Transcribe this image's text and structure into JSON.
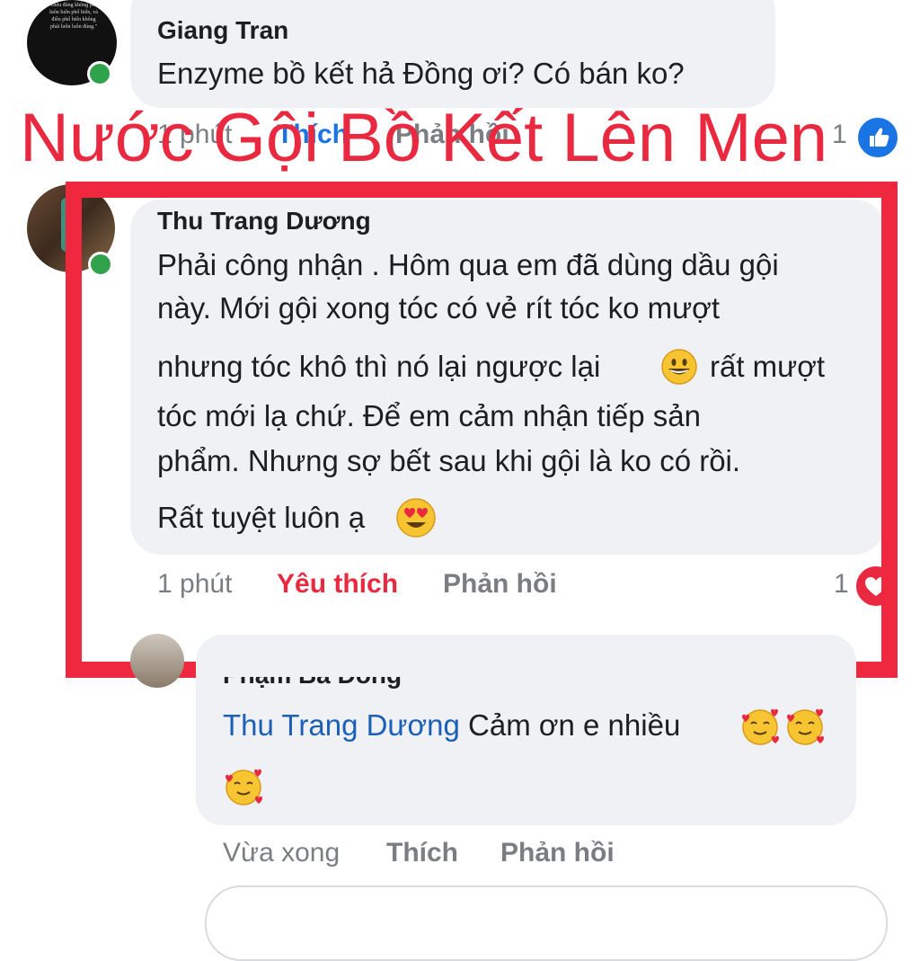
{
  "comments": [
    {
      "author": "Giang Tran",
      "text": "Enzyme bồ kết hả Đồng ơi? Có bán ko?",
      "time": "1 phút",
      "like_label": "Thích",
      "reply_label": "Phản hồi",
      "reaction_count": "1",
      "avatar_text": "\"Điều đúng không phải luôn luôn phổ biến, và điều phổ biến không phải luôn luôn đúng.\""
    },
    {
      "author": "Thu Trang Dương",
      "lines": [
        "Phải công nhận . Hôm qua em đã dùng dầu gội",
        "này. Mới gội xong tóc có vẻ rít tóc ko mượt",
        "nhưng tóc khô thì nó lại ngược lại",
        "rất mượt",
        "tóc mới lạ chứ. Để em cảm nhận tiếp sản",
        "phẩm. Nhưng sợ bết sau khi gội là ko có rồi.",
        "Rất tuyệt luôn ạ"
      ],
      "time": "1 phút",
      "like_label": "Yêu thích",
      "reply_label": "Phản hồi",
      "reaction_count": "1"
    },
    {
      "author": "Phạm Bá Đồng",
      "mention": "Thu Trang Dương",
      "text": "Cảm ơn e nhiều",
      "time": "Vừa xong",
      "like_label": "Thích",
      "reply_label": "Phản hồi"
    }
  ],
  "overlay_title": "Nước Gội Bồ Kết Lên Men",
  "colors": {
    "overlay_red": "#e8293f",
    "box_red": "#f0283f",
    "bubble_bg": "#eff1f4",
    "love_red": "#e8293f",
    "like_blue": "#1b74e4",
    "online_green": "#31a24c"
  },
  "icons": [
    "like-reaction-icon",
    "love-reaction-icon",
    "grinning-emoji",
    "heart-eyes-emoji",
    "smiling-hearts-emoji"
  ]
}
